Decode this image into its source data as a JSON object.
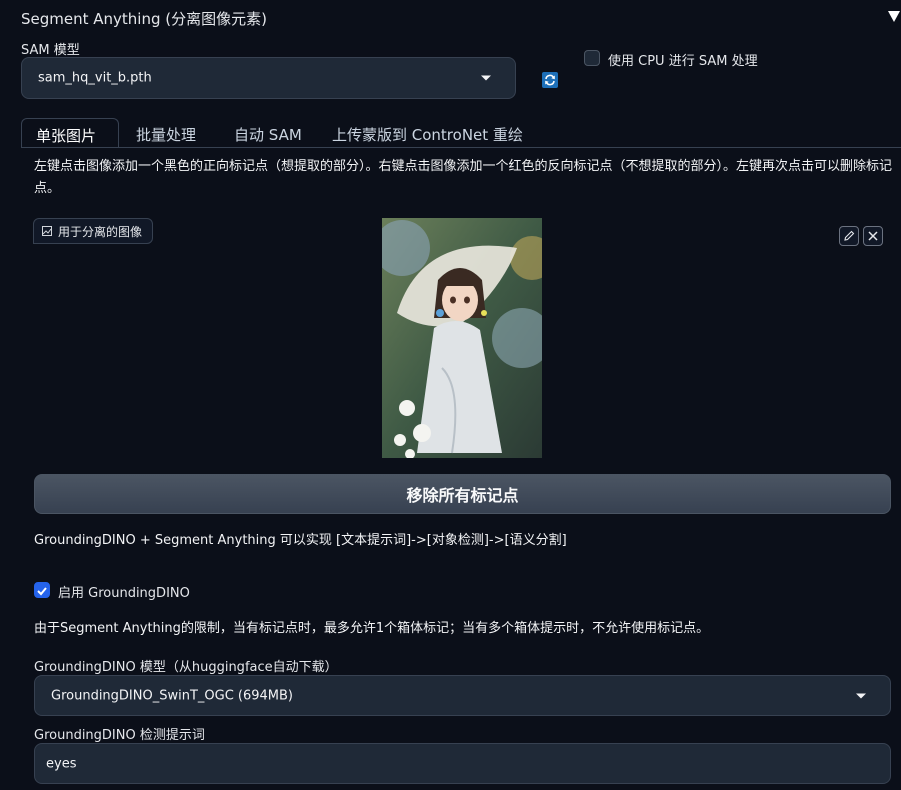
{
  "accordion": {
    "title": "Segment Anything (分离图像元素)"
  },
  "sam": {
    "model_label": "SAM 模型",
    "model_value": "sam_hq_vit_b.pth",
    "cpu_label": "使用 CPU 进行 SAM 处理",
    "cpu_checked": false
  },
  "tabs": [
    {
      "label": "单张图片",
      "active": true
    },
    {
      "label": "批量处理",
      "active": false
    },
    {
      "label": "自动 SAM",
      "active": false
    },
    {
      "label": "上传蒙版到 ControNet 重绘",
      "active": false
    }
  ],
  "instructions": "左键点击图像添加一个黑色的正向标记点（想提取的部分）。右键点击图像添加一个红色的反向标记点（不想提取的部分）。左键再次点击可以删除标记点。",
  "image_panel": {
    "label": "用于分离的图像"
  },
  "clear_points_button": "移除所有标记点",
  "grounding": {
    "intro": "GroundingDINO + Segment Anything 可以实现 [文本提示词]->[对象检测]->[语义分割]",
    "enable_label": "启用 GroundingDINO",
    "enable_checked": true,
    "limitation_note": "由于Segment Anything的限制，当有标记点时，最多允许1个箱体标记；当有多个箱体提示时，不允许使用标记点。",
    "model_label": "GroundingDINO 模型（从huggingface自动下载）",
    "model_value": "GroundingDINO_SwinT_OGC (694MB)",
    "prompt_label": "GroundingDINO 检测提示词",
    "prompt_value": "eyes"
  },
  "colors": {
    "background": "#0b0f19",
    "accent": "#2563eb",
    "refresh": "#1d6fb8"
  },
  "icons": [
    "collapse-triangle-icon",
    "refresh-icon",
    "image-icon",
    "edit-pencil-icon",
    "close-icon",
    "check-icon",
    "dropdown-caret-icon"
  ]
}
